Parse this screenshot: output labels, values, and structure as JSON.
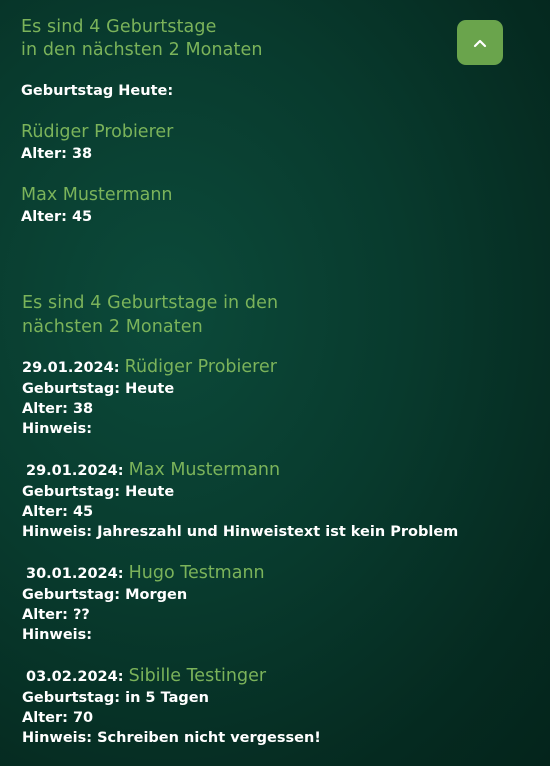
{
  "widget1": {
    "title": "Es sind 4 Geburtstage\nin den nächsten 2 Monaten",
    "today_label": "Geburtstag Heute:",
    "people": [
      {
        "name": "Rüdiger Probierer",
        "age": "Alter: 38"
      },
      {
        "name": "Max Mustermann",
        "age": "Alter: 45"
      }
    ]
  },
  "widget2": {
    "title": "Es sind 4 Geburtstage in den\nnächsten 2 Monaten",
    "entries": [
      {
        "date": "29.01.2024:",
        "name": "Rüdiger Probierer",
        "birthday": "Geburtstag: Heute",
        "age": "Alter: 38",
        "note": "Hinweis:"
      },
      {
        "date": "29.01.2024:",
        "name": "Max Mustermann",
        "birthday": "Geburtstag: Heute",
        "age": "Alter: 45",
        "note": "Hinweis: Jahreszahl und Hinweistext ist kein Problem"
      },
      {
        "date": "30.01.2024:",
        "name": "Hugo Testmann",
        "birthday": "Geburtstag: Morgen",
        "age": "Alter: ??",
        "note": "Hinweis:"
      },
      {
        "date": "03.02.2024:",
        "name": "Sibille Testinger",
        "birthday": "Geburtstag: in 5 Tagen",
        "age": "Alter: 70",
        "note": "Hinweis: Schreiben nicht vergessen!"
      }
    ]
  },
  "scroll_top_button": {
    "icon": "chevron-up-icon"
  },
  "colors": {
    "accent": "#7bb35a",
    "button": "#6aa44c",
    "background": "#083a2d"
  }
}
